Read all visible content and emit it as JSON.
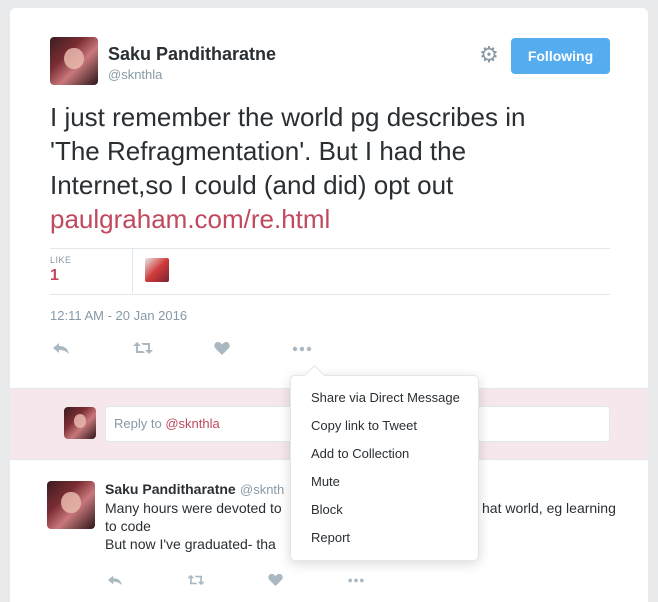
{
  "tweet": {
    "author_name": "Saku Panditharatne",
    "author_handle": "@sknthla",
    "follow_label": "Following",
    "text_lines": [
      "I just remember the world pg describes in",
      "'The Refragmentation'. But I had the",
      "Internet,so I could (and did) opt out"
    ],
    "link": "paulgraham.com/re.html",
    "like_label": "LIKE",
    "like_count": "1",
    "timestamp": "12:11 AM - 20 Jan 2016"
  },
  "reply_box": {
    "placeholder_prefix": "Reply to ",
    "mention": "@sknthla"
  },
  "reply_tweet": {
    "author_name": "Saku Panditharatne",
    "author_handle_visible": "@sknth",
    "text_lines": [
      "Many hours were devoted to",
      "hat world, eg learning",
      "to code",
      "But now I've graduated- tha"
    ]
  },
  "dropdown_menu": {
    "items": [
      "Share via Direct Message",
      "Copy link to Tweet",
      "Add to Collection",
      "Mute",
      "Block",
      "Report"
    ]
  },
  "icons": {
    "gear": "gear-icon",
    "reply": "reply-icon",
    "retweet": "retweet-icon",
    "like": "heart-icon",
    "more": "more-icon"
  },
  "colors": {
    "accent_blue": "#55acee",
    "link_red": "#c0495d",
    "reply_bg": "#f5e7eb"
  }
}
